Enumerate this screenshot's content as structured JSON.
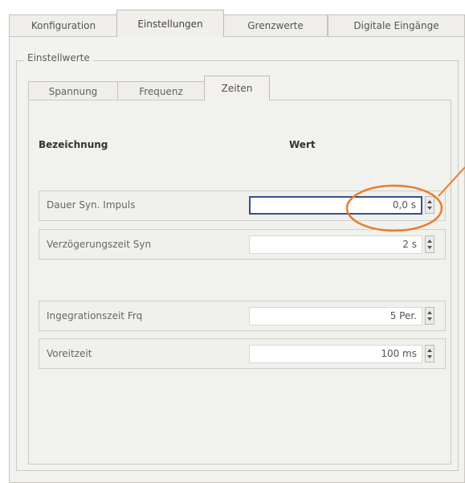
{
  "top_tabs": [
    {
      "label": "Konfiguration"
    },
    {
      "label": "Einstellungen",
      "active": true
    },
    {
      "label": "Grenzwerte"
    },
    {
      "label": "Digitale Eingänge"
    }
  ],
  "group": {
    "title": "Einstellwerte"
  },
  "sub_tabs": [
    {
      "label": "Spannung"
    },
    {
      "label": "Frequenz"
    },
    {
      "label": "Zeiten",
      "active": true
    }
  ],
  "headers": {
    "name": "Bezeichnung",
    "value": "Wert"
  },
  "rows": [
    {
      "label": "Dauer Syn. Impuls",
      "value": "0,0 s",
      "focused": true
    },
    {
      "label": "Verzögerungszeit Syn",
      "value": "2 s"
    },
    {
      "label": "Ingegrationszeit Frq",
      "value": "5 Per."
    },
    {
      "label": "Voreitzeit",
      "value": "100 ms"
    }
  ],
  "colors": {
    "highlight": "#e87d2c",
    "focus_border": "#374f92"
  }
}
